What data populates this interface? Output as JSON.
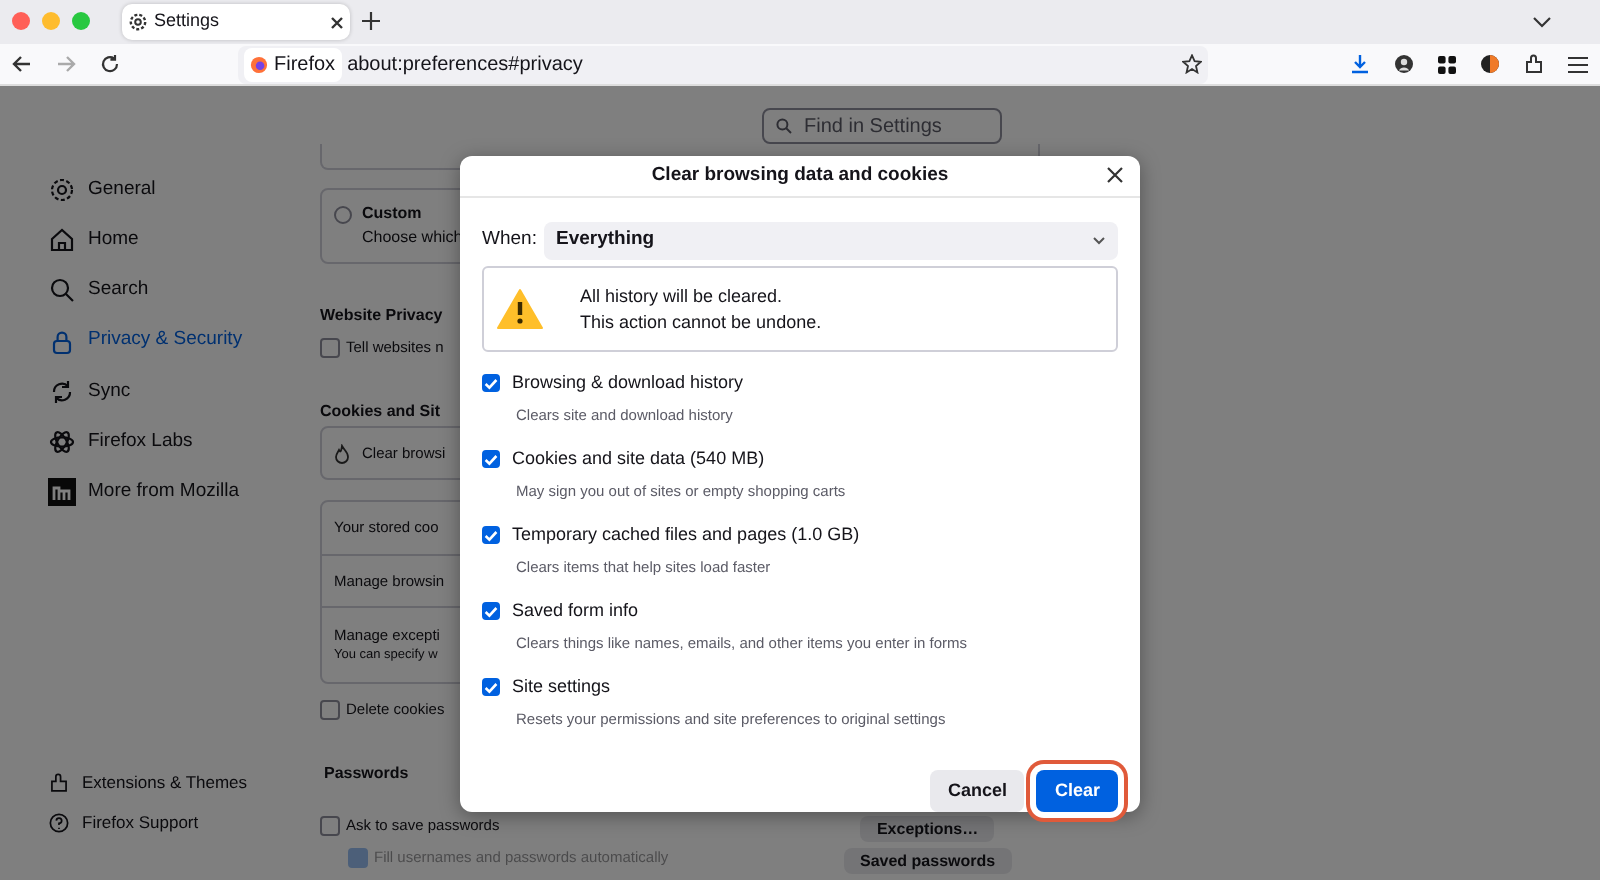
{
  "window": {
    "tab": {
      "title": "Settings"
    }
  },
  "address_bar": {
    "identity": "Firefox",
    "url": "about:preferences#privacy"
  },
  "search": {
    "placeholder": "Find in Settings"
  },
  "sidebar": {
    "items": [
      {
        "label": "General",
        "selected": false
      },
      {
        "label": "Home",
        "selected": false
      },
      {
        "label": "Search",
        "selected": false
      },
      {
        "label": "Privacy & Security",
        "selected": true
      },
      {
        "label": "Sync",
        "selected": false
      },
      {
        "label": "Firefox Labs",
        "selected": false
      },
      {
        "label": "More from Mozilla",
        "selected": false
      }
    ],
    "footer": [
      "Extensions & Themes",
      "Firefox Support"
    ]
  },
  "page": {
    "custom_option": {
      "title": "Custom",
      "description": "Choose which",
      "selected": false
    },
    "website_privacy": {
      "heading": "Website Privacy",
      "checkbox": {
        "label": "Tell websites n",
        "checked": false
      }
    },
    "cookies": {
      "heading": "Cookies and Sit",
      "clear_button": "Clear browsi",
      "rows": [
        {
          "label": "Your stored coo"
        },
        {
          "label": "Manage browsin"
        },
        {
          "label": "Manage excepti",
          "description": "You can specify w"
        }
      ],
      "delete_checkbox": {
        "label": "Delete cookies",
        "checked": false
      }
    },
    "passwords": {
      "heading": "Passwords",
      "checkboxes": [
        {
          "label": "Ask to save passwords",
          "checked": false,
          "disabled": false
        },
        {
          "label": "Fill usernames and passwords automatically",
          "checked": true,
          "disabled": true
        }
      ],
      "buttons": [
        "Exceptions…",
        "Saved passwords"
      ]
    }
  },
  "dialog": {
    "title": "Clear browsing data and cookies",
    "when_label": "When:",
    "when_value": "Everything",
    "warning": [
      "All history will be cleared.",
      "This action cannot be undone."
    ],
    "options": [
      {
        "label": "Browsing & download history",
        "description": "Clears site and download history",
        "checked": true
      },
      {
        "label": "Cookies and site data (540 MB)",
        "description": "May sign you out of sites or empty shopping carts",
        "checked": true
      },
      {
        "label": "Temporary cached files and pages (1.0 GB)",
        "description": "Clears items that help sites load faster",
        "checked": true
      },
      {
        "label": "Saved form info",
        "description": "Clears things like names, emails, and other items you enter in forms",
        "checked": true
      },
      {
        "label": "Site settings",
        "description": "Resets your permissions and site preferences to original settings",
        "checked": true
      }
    ],
    "buttons": [
      {
        "label": "Cancel",
        "kind": "secondary",
        "highlighted": false
      },
      {
        "label": "Clear",
        "kind": "primary",
        "highlighted": true
      }
    ]
  }
}
